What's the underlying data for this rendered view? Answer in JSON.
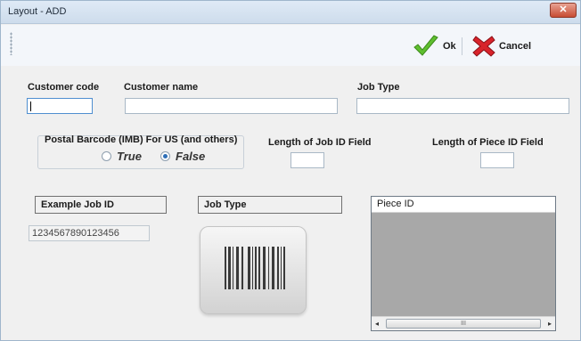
{
  "window": {
    "title": "Layout - ADD",
    "close_glyph": "✕"
  },
  "toolbar": {
    "ok_label": "Ok",
    "cancel_label": "Cancel"
  },
  "form": {
    "customer_code": {
      "label": "Customer code",
      "value": ""
    },
    "customer_name": {
      "label": "Customer name",
      "value": ""
    },
    "job_type": {
      "label": "Job Type",
      "value": ""
    },
    "postal_barcode": {
      "label": "Postal Barcode  (IMB) For US (and others)",
      "options": [
        "True",
        "False"
      ],
      "selected": "False"
    },
    "job_id_length": {
      "label": "Length of Job ID Field",
      "value": ""
    },
    "piece_id_length": {
      "label": "Length of Piece ID Field",
      "value": ""
    }
  },
  "preview": {
    "example_job_id_header": "Example Job ID",
    "example_job_id_value": "1234567890123456",
    "job_type_header": "Job Type",
    "piece_id_header": "Piece ID",
    "scroll_thumb_glyph": "III",
    "scroll_left_glyph": "◂",
    "scroll_right_glyph": "▸"
  },
  "colors": {
    "ok_check": "#5fbf2f",
    "cancel_x": "#d8232a",
    "titlebar": "#cddcec"
  },
  "icons": {
    "ok": "checkmark-icon",
    "cancel": "red-x-icon",
    "barcode": "barcode-icon"
  }
}
